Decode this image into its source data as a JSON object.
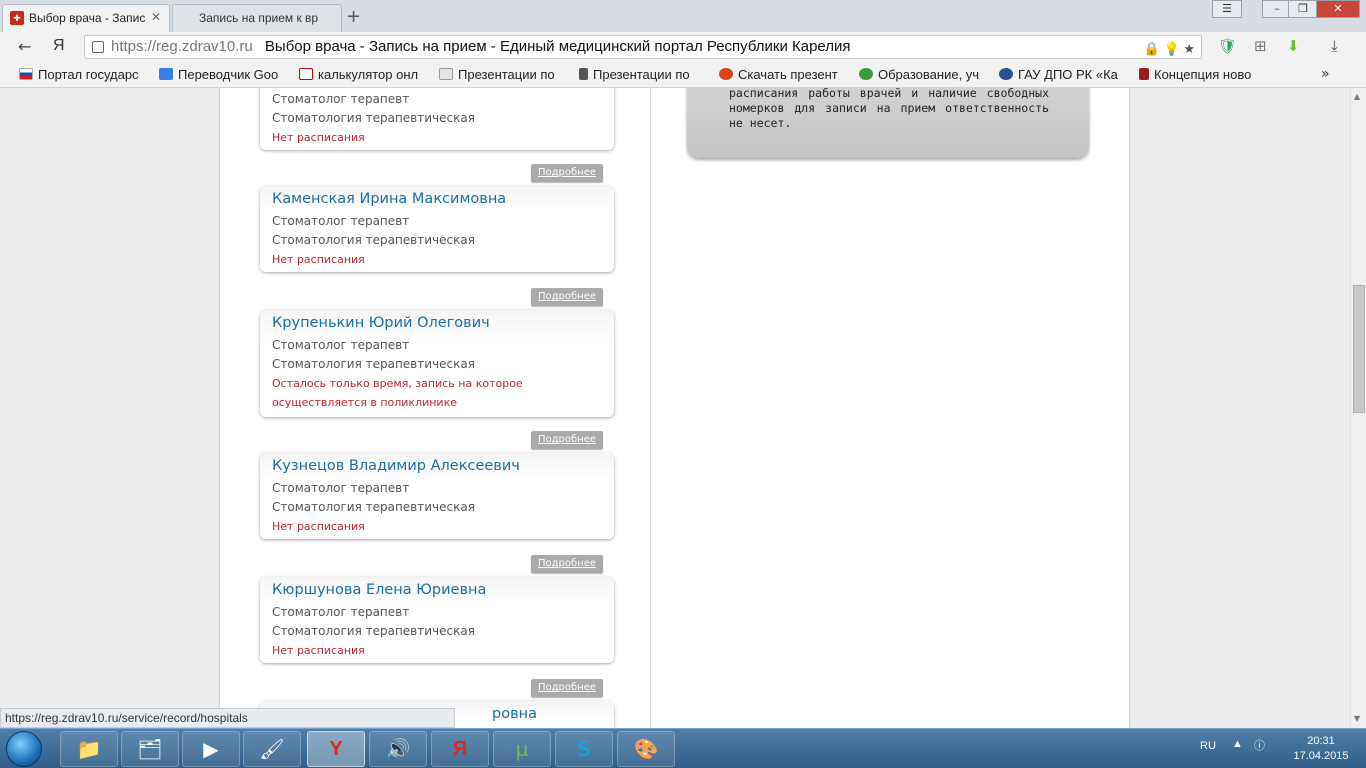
{
  "browser": {
    "tabs": [
      {
        "label": "Выбор врача - Запис",
        "active": true
      },
      {
        "label": "Запись на прием к вр",
        "active": false
      }
    ],
    "url_host": "https://reg.zdrav10.ru",
    "page_title": "Выбор врача - Запись на прием - Единый медицинский портал Республики Карелия",
    "bookmarks": [
      "Портал государс",
      "Переводчик Goo",
      "калькулятор онл",
      "Презентации по",
      "Презентации по",
      "Скачать презент",
      "Образование, уч",
      "ГАУ ДПО РК «Ка",
      "Концепция ново"
    ],
    "bookmarks_more": "»",
    "status_url": "https://reg.zdrav10.ru/service/record/hospitals"
  },
  "page": {
    "partial_card": {
      "specialty": "Стоматолог терапевт",
      "department": "Стоматология терапевтическая",
      "status": "Нет расписания"
    },
    "details_label": "Подробнее",
    "doctors": [
      {
        "name": "Каменская Ирина Максимовна",
        "specialty": "Стоматолог терапевт",
        "department": "Стоматология терапевтическая",
        "status": "Нет расписания"
      },
      {
        "name": "Крупенькин Юрий Олегович",
        "specialty": "Стоматолог терапевт",
        "department": "Стоматология терапевтическая",
        "status": "Осталось только время, запись на которое осуществляется в поликлинике"
      },
      {
        "name": "Кузнецов Владимир Алексеевич",
        "specialty": "Стоматолог терапевт",
        "department": "Стоматология терапевтическая",
        "status": "Нет расписания"
      },
      {
        "name": "Кюршунова Елена Юриевна",
        "specialty": "Стоматолог терапевт",
        "department": "Стоматология терапевтическая",
        "status": "Нет расписания"
      }
    ],
    "partial_bottom_name": "ровна",
    "info_text": "расписания работы врачей и наличие свободных номерков для записи на прием ответственность не несет."
  },
  "taskbar": {
    "language": "RU",
    "time": "20:31",
    "date": "17.04.2015"
  },
  "colors": {
    "link": "#1a6ea6",
    "status_red": "#c0242c",
    "details_button": "#aaaaaa"
  }
}
